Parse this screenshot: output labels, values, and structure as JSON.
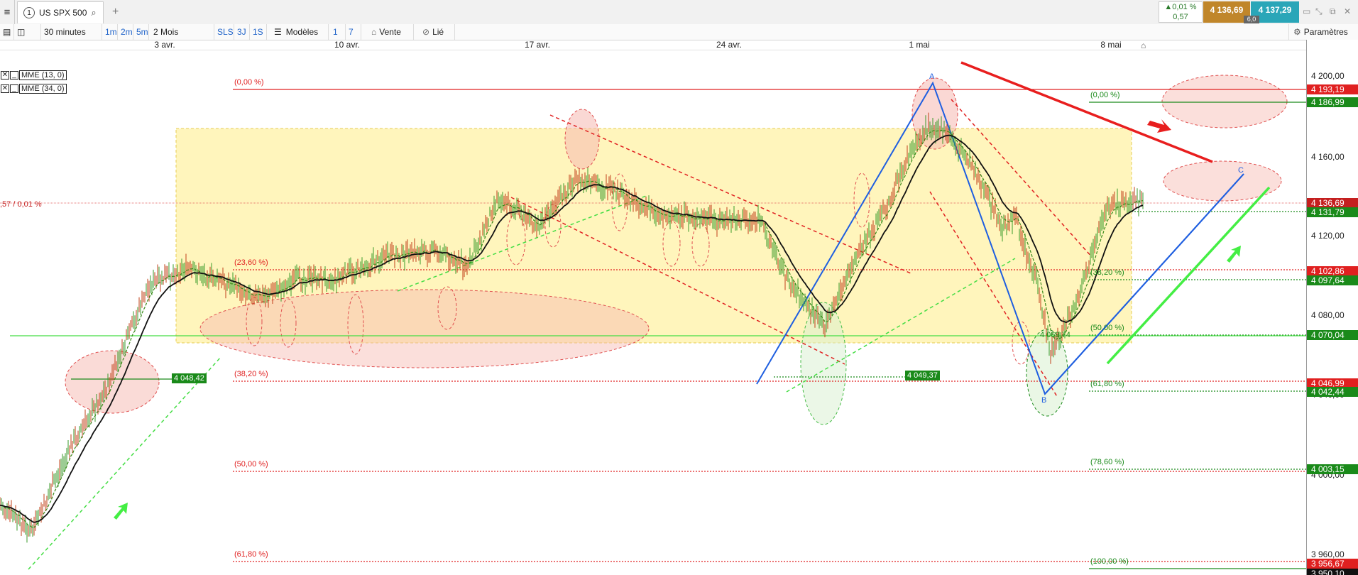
{
  "tabbar": {
    "menu_icon": "hamburger-icon",
    "tab_number": "1",
    "instrument": "US SPX 500",
    "search_icon": "magnifier-icon",
    "add_tab": "+",
    "change_pct": "▲0,01 %",
    "change_abs": "0,57",
    "bid": "4 136,69",
    "ask": "4 137,29",
    "spread": "6,0",
    "window_controls": [
      "minimize-icon",
      "restore-icon",
      "popout-icon",
      "close-icon"
    ]
  },
  "toolbar": {
    "interval": "30 minutes",
    "quick_intervals": [
      "1m",
      "2m",
      "5m"
    ],
    "period": "2 Mois",
    "ranges": [
      "SLS",
      "3J",
      "1S"
    ],
    "models": "Modèles",
    "zoom": [
      "1",
      "7"
    ],
    "sell": "Vente",
    "linked": "Lié",
    "settings": "Paramètres"
  },
  "date_axis": [
    "3 avr.",
    "10 avr.",
    "17 avr.",
    "24 avr.",
    "1 mai",
    "8 mai"
  ],
  "indicators": [
    {
      "name": "MME (13, 0)"
    },
    {
      "name": "MME (34, 0)"
    }
  ],
  "price_axis": {
    "ticks": [
      "4 200,00",
      "4 160,00",
      "4 120,00",
      "4 080,00",
      "4 040,00",
      "4 000,00",
      "3 960,00"
    ],
    "tags": [
      {
        "text": "4 193,19",
        "color": "#e02020"
      },
      {
        "text": "4 186,99",
        "color": "#1a8a1a"
      },
      {
        "text": "4 136,69",
        "color": "#c41f1f"
      },
      {
        "text": "4 131,79",
        "color": "#1a8a1a"
      },
      {
        "text": "4 102,86",
        "color": "#e02020"
      },
      {
        "text": "4 097,64",
        "color": "#1a8a1a"
      },
      {
        "text": "4 070,04",
        "color": "#1a8a1a"
      },
      {
        "text": "4 046,99",
        "color": "#e02020"
      },
      {
        "text": "4 042,44",
        "color": "#1a8a1a"
      },
      {
        "text": "4 003,15",
        "color": "#1a8a1a"
      },
      {
        "text": "3 956,67",
        "color": "#e02020"
      },
      {
        "text": "3 950,10",
        "color": "#111111"
      }
    ]
  },
  "chart": {
    "last_change_label": ",57 / 0,01 %",
    "fib_left": [
      "(0,00 %)",
      "(23,60 %)",
      "(38,20 %)",
      "(50,00 %)",
      "(61,80 %)"
    ],
    "fib_right": [
      "(0,00 %)",
      "(38,20 %)",
      "(50,00 %)",
      "(61,80 %)",
      "(78,60 %)",
      "(100,00 %)"
    ],
    "level_tags": [
      "4 048,42",
      "4 049,37",
      "4 069,74"
    ],
    "wave_labels": [
      "A",
      "B",
      "C"
    ],
    "colors": {
      "support": "#1a8a1a",
      "resistance": "#e02020",
      "zone": "#fff3b0",
      "wave": "#1f5fe0",
      "arrow_up": "#44ee44"
    }
  }
}
